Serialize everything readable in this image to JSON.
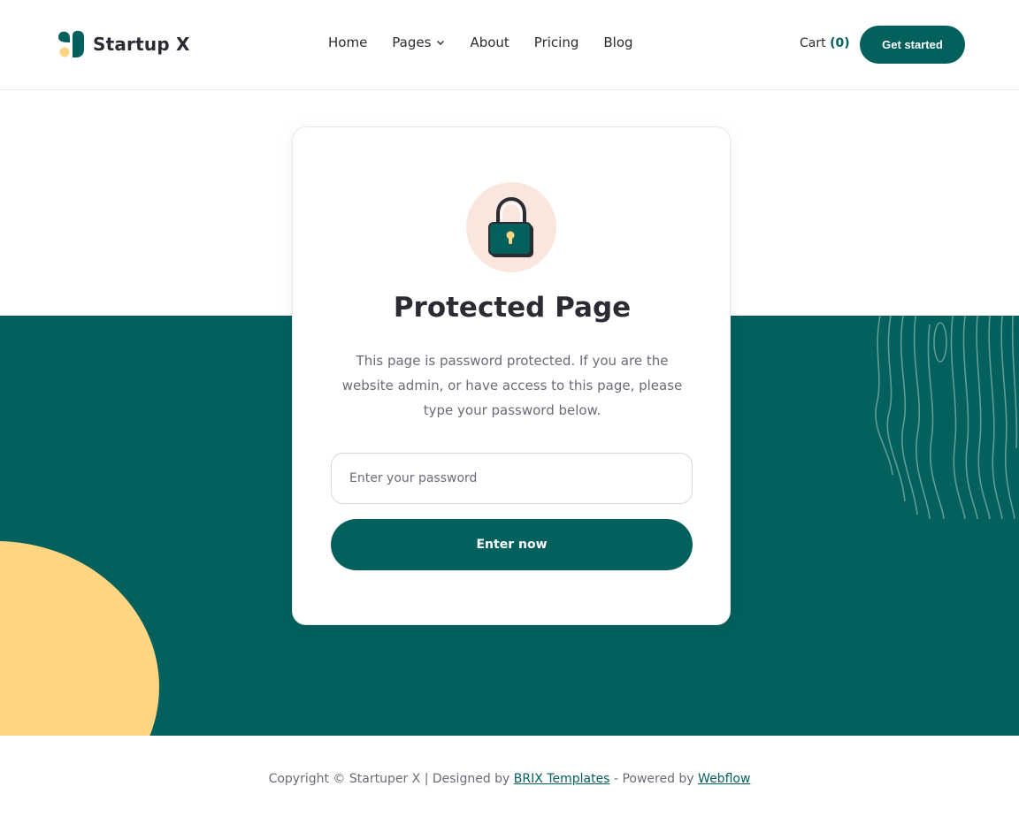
{
  "brand": {
    "name": "Startup X",
    "colors": {
      "primary": "#03605d",
      "accent": "#fdd583",
      "soft": "#f9e7dd"
    }
  },
  "nav": {
    "items": [
      {
        "label": "Home"
      },
      {
        "label": "Pages",
        "icon": "chevron-down-icon"
      },
      {
        "label": "About"
      },
      {
        "label": "Pricing"
      },
      {
        "label": "Blog"
      }
    ],
    "cart_label": "Cart",
    "cart_count": "(0)",
    "cta_label": "Get started"
  },
  "card": {
    "icon": "lock-icon",
    "title": "Protected Page",
    "description": "This page is password protected. If you are the website admin, or have access to this page, please type your password below.",
    "password_placeholder": "Enter your password",
    "submit_label": "Enter now"
  },
  "footer": {
    "prefix": "Copyright © Startuper X | Designed by",
    "designer_link": "BRIX Templates",
    "middle": "- Powered by",
    "platform_link": "Webflow"
  }
}
